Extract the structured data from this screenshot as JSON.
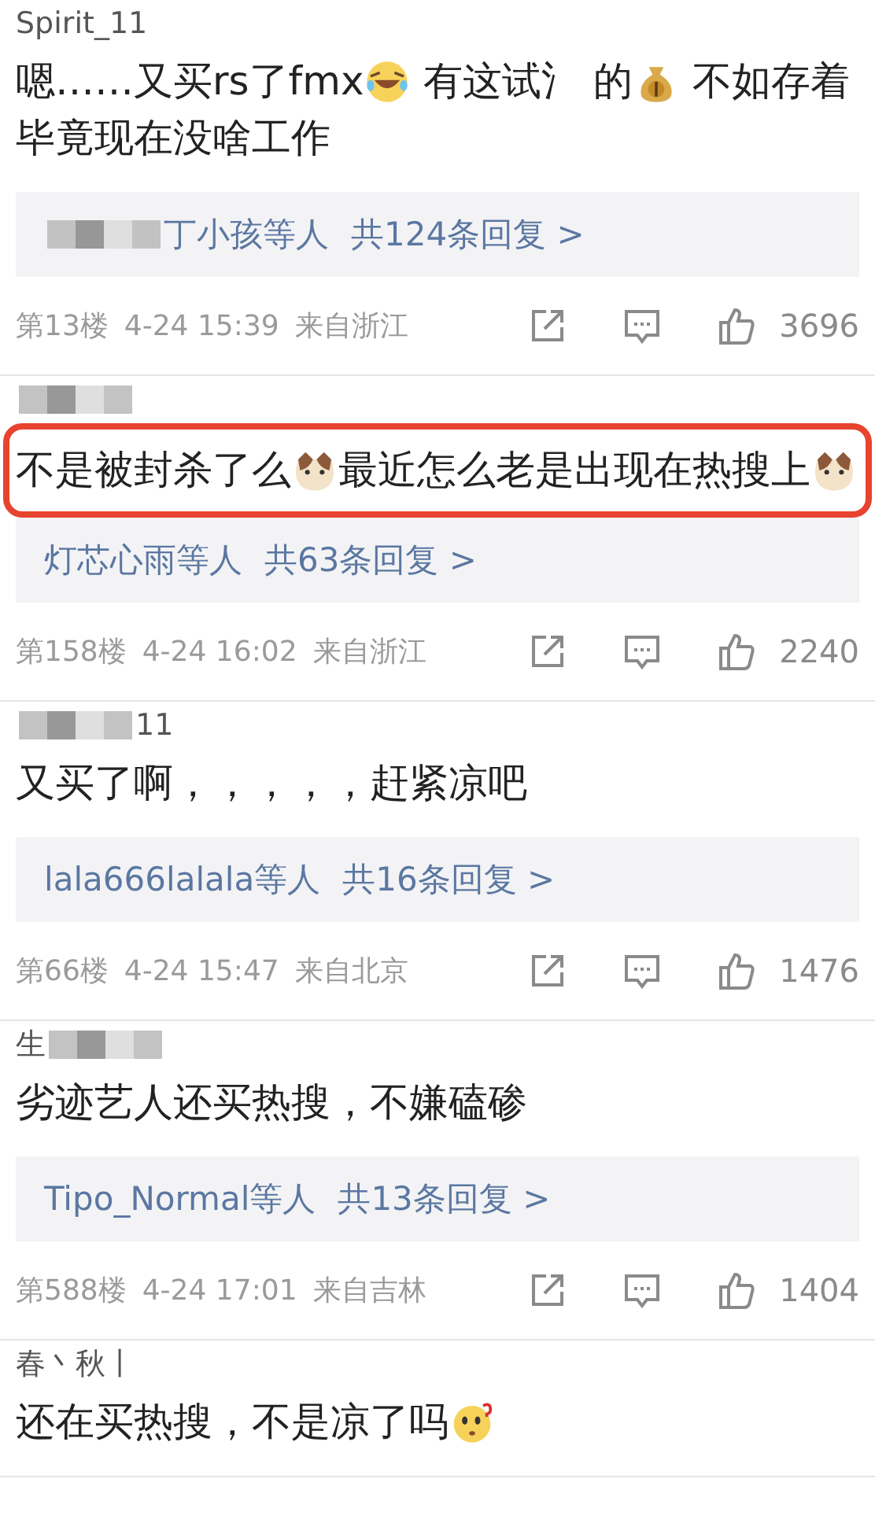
{
  "comments": [
    {
      "user": [
        {
          "kind": "text",
          "text": "Spirit_11"
        }
      ],
      "highlighted": false,
      "content": [
        {
          "kind": "text",
          "text": "嗯……又买rs了fmx"
        },
        {
          "kind": "laugh-cry"
        },
        {
          "kind": "text",
          "text": " 有这试氵 的"
        },
        {
          "kind": "money-bag"
        },
        {
          "kind": "text",
          "text": " 不如存着"
        },
        {
          "kind": "line",
          "text": "毕竟现在没啥工作"
        }
      ],
      "replies": {
        "names": [
          {
            "kind": "blur"
          },
          {
            "kind": "text",
            "text": "丁小孩等人"
          }
        ],
        "count": "共124条回复 >"
      },
      "floor": "第13楼",
      "time": "4-24 15:39",
      "location": "来自浙江",
      "likes": "3696"
    },
    {
      "user": [
        {
          "kind": "blur"
        }
      ],
      "highlighted": true,
      "content": [
        {
          "kind": "text",
          "text": "不是被封杀了么"
        },
        {
          "kind": "cat"
        },
        {
          "kind": "text",
          "text": "最近怎么老是出现在热搜上"
        },
        {
          "kind": "cat"
        }
      ],
      "replies": {
        "names": [
          {
            "kind": "text",
            "text": "灯芯心雨等人"
          }
        ],
        "count": "共63条回复 >"
      },
      "floor": "第158楼",
      "time": "4-24 16:02",
      "location": "来自浙江",
      "likes": "2240"
    },
    {
      "user": [
        {
          "kind": "blur"
        },
        {
          "kind": "text",
          "text": "11"
        }
      ],
      "highlighted": false,
      "content": [
        {
          "kind": "text",
          "text": "又买了啊，，，，，赶紧凉吧"
        }
      ],
      "replies": {
        "names": [
          {
            "kind": "text",
            "text": "lala666lalala等人"
          }
        ],
        "count": "共16条回复 >"
      },
      "floor": "第66楼",
      "time": "4-24 15:47",
      "location": "来自北京",
      "likes": "1476"
    },
    {
      "user": [
        {
          "kind": "text",
          "text": "生"
        },
        {
          "kind": "blur"
        }
      ],
      "highlighted": false,
      "content": [
        {
          "kind": "text",
          "text": "劣迹艺人还买热搜，不嫌磕碜"
        }
      ],
      "replies": {
        "names": [
          {
            "kind": "text",
            "text": "Tipo_Normal等人"
          }
        ],
        "count": "共13条回复 >"
      },
      "floor": "第588楼",
      "time": "4-24 17:01",
      "location": "来自吉林",
      "likes": "1404"
    },
    {
      "user": [
        {
          "kind": "text",
          "text": "春丶秋丨"
        }
      ],
      "highlighted": false,
      "content": [
        {
          "kind": "text",
          "text": "还在买热搜，不是凉了吗"
        },
        {
          "kind": "thinking"
        }
      ]
    }
  ]
}
